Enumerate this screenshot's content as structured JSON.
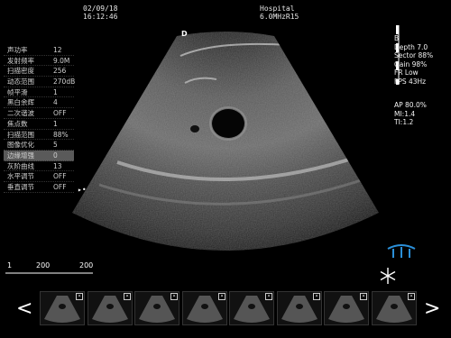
{
  "header": {
    "date": "02/09/18",
    "time": "16:12:46",
    "hospital": "Hospital",
    "probe": "6.0MHzR15"
  },
  "params": [
    {
      "label": "声功率",
      "value": "12"
    },
    {
      "label": "发射频率",
      "value": "9.0M"
    },
    {
      "label": "扫描密度",
      "value": "256"
    },
    {
      "label": "动态范围",
      "value": "270dB"
    },
    {
      "label": "帧平滑",
      "value": "1"
    },
    {
      "label": "黑白余辉",
      "value": "4"
    },
    {
      "label": "二次谐波",
      "value": "OFF"
    },
    {
      "label": "焦点数",
      "value": "1"
    },
    {
      "label": "扫描范围",
      "value": "88%"
    },
    {
      "label": "图像优化",
      "value": "5"
    },
    {
      "label": "边缘增强",
      "value": "0"
    },
    {
      "label": "灰阶曲线",
      "value": "13"
    },
    {
      "label": "水平调节",
      "value": "OFF"
    },
    {
      "label": "垂直调节",
      "value": "OFF"
    }
  ],
  "selected_param_index": 10,
  "image_label": "D",
  "info": {
    "mode": "B",
    "depth": "Depth 7.0",
    "sector": "Sector 88%",
    "gain": "Gain 98%",
    "fr": "FR Low",
    "fps": "FPS 43Hz",
    "ap": "AP 80.0%",
    "mi": "MI:1.4",
    "ti": "TI:1.2"
  },
  "scale": {
    "left": "1",
    "mid": "200",
    "right": "200"
  },
  "icons": {
    "prev": "chevron-left-icon",
    "next": "chevron-right-icon",
    "probe": "probe-icon",
    "freeze": "snowflake-icon",
    "thumb_close": "close-icon"
  },
  "thumbnail_count": 8,
  "nav": {
    "prev": "<",
    "next": ">"
  }
}
